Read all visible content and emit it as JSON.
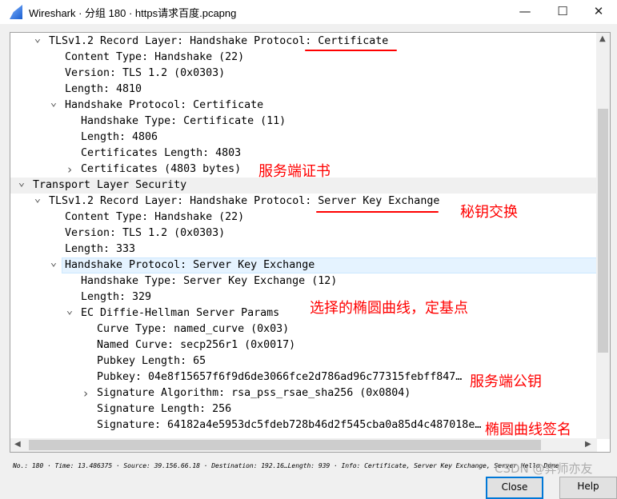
{
  "window": {
    "title": "Wireshark · 分组 180 · https请求百度.pcapng",
    "minimize": "—",
    "maximize": "☐",
    "close": "✕"
  },
  "tree": {
    "rows": [
      {
        "level": 1,
        "state": "expanded",
        "text": "TLSv1.2 Record Layer: Handshake Protocol: Certificate"
      },
      {
        "level": 2,
        "state": "leaf",
        "text": "Content Type: Handshake (22)"
      },
      {
        "level": 2,
        "state": "leaf",
        "text": "Version: TLS 1.2 (0x0303)"
      },
      {
        "level": 2,
        "state": "leaf",
        "text": "Length: 4810"
      },
      {
        "level": 2,
        "state": "expanded",
        "text": "Handshake Protocol: Certificate"
      },
      {
        "level": 3,
        "state": "leaf",
        "text": "Handshake Type: Certificate (11)"
      },
      {
        "level": 3,
        "state": "leaf",
        "text": "Length: 4806"
      },
      {
        "level": 3,
        "state": "leaf",
        "text": "Certificates Length: 4803"
      },
      {
        "level": 3,
        "state": "collapsed",
        "text": "Certificates (4803 bytes)"
      },
      {
        "level": 0,
        "state": "expanded",
        "text": "Transport Layer Security",
        "section": true
      },
      {
        "level": 1,
        "state": "expanded",
        "text": "TLSv1.2 Record Layer: Handshake Protocol: Server Key Exchange"
      },
      {
        "level": 2,
        "state": "leaf",
        "text": "Content Type: Handshake (22)"
      },
      {
        "level": 2,
        "state": "leaf",
        "text": "Version: TLS 1.2 (0x0303)"
      },
      {
        "level": 2,
        "state": "leaf",
        "text": "Length: 333"
      },
      {
        "level": 2,
        "state": "expanded",
        "text": "Handshake Protocol: Server Key Exchange",
        "selected": true
      },
      {
        "level": 3,
        "state": "leaf",
        "text": "Handshake Type: Server Key Exchange (12)"
      },
      {
        "level": 3,
        "state": "leaf",
        "text": "Length: 329"
      },
      {
        "level": 3,
        "state": "expanded",
        "text": "EC Diffie-Hellman Server Params"
      },
      {
        "level": 4,
        "state": "leaf",
        "text": "Curve Type: named_curve (0x03)"
      },
      {
        "level": 4,
        "state": "leaf",
        "text": "Named Curve: secp256r1 (0x0017)"
      },
      {
        "level": 4,
        "state": "leaf",
        "text": "Pubkey Length: 65"
      },
      {
        "level": 4,
        "state": "leaf",
        "text": "Pubkey: 04e8f15657f6f9d6de3066fce2d786ad96c77315febff847…"
      },
      {
        "level": 4,
        "state": "collapsed",
        "text": "Signature Algorithm: rsa_pss_rsae_sha256 (0x0804)"
      },
      {
        "level": 4,
        "state": "leaf",
        "text": "Signature Length: 256"
      },
      {
        "level": 4,
        "state": "leaf",
        "text": "Signature: 64182a4e5953dc5fdeb728b46d2f545cba0a85d4c487018e…"
      }
    ]
  },
  "annotations": {
    "cert": "服务端证书",
    "key_exchange": "秘钥交换",
    "curve": "选择的椭圆曲线，定基点",
    "pubkey": "服务端公钥",
    "signature": "椭圆曲线签名",
    "color": "#ff0000"
  },
  "status": "No.: 180 · Time: 13.486375 · Source: 39.156.66.18 · Destination: 192.16…Length: 939 · Info: Certificate, Server Key Exchange, Server Hello Done",
  "watermark": "CSDN @弈师亦友",
  "buttons": {
    "close": "Close",
    "help": "Help"
  },
  "colors": {
    "selection": "#e5f3ff",
    "annotation": "#ff0000"
  }
}
